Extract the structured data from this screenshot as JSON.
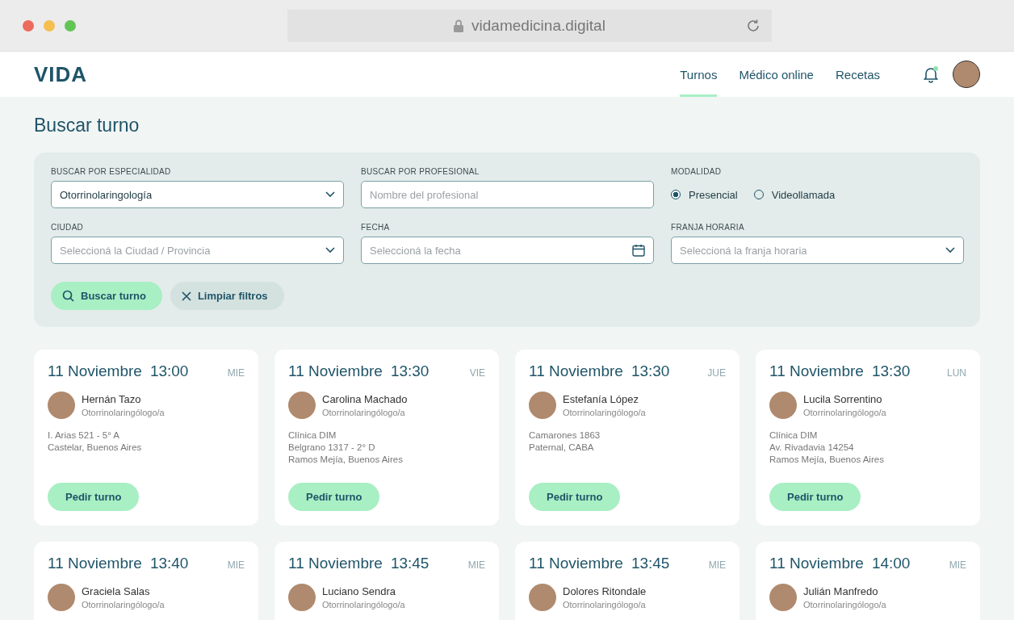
{
  "browser": {
    "url": "vidamedicina.digital"
  },
  "header": {
    "logo": "VIDA",
    "nav": [
      {
        "label": "Turnos",
        "selected": true
      },
      {
        "label": "Médico online",
        "selected": false
      },
      {
        "label": "Recetas",
        "selected": false
      }
    ],
    "notifications_unread": true
  },
  "page_title": "Buscar turno",
  "filters": {
    "especialidad": {
      "label": "BUSCAR POR ESPECIALIDAD",
      "value": "Otorrinolaringología"
    },
    "profesional": {
      "label": "BUSCAR POR PROFESIONAL",
      "placeholder": "Nombre del profesional"
    },
    "modalidad": {
      "label": "MODALIDAD",
      "options": [
        {
          "label": "Presencial",
          "selected": true
        },
        {
          "label": "Videollamada",
          "selected": false
        }
      ]
    },
    "ciudad": {
      "label": "CIUDAD",
      "placeholder": "Seleccioná la Ciudad / Provincia"
    },
    "fecha": {
      "label": "FECHA",
      "placeholder": "Seleccioná la fecha"
    },
    "franja": {
      "label": "FRANJA HORARIA",
      "placeholder": "Seleccioná la franja horaria"
    },
    "buttons": [
      {
        "label": "Buscar turno",
        "kind": "search"
      },
      {
        "label": "Limpiar filtros",
        "kind": "clear"
      }
    ]
  },
  "results": [
    {
      "date": "11 Noviembre",
      "time": "13:00",
      "weekday": "MIE",
      "doctor": "Hernán Tazo",
      "specialty": "Otorrinolaringólogo/a",
      "address": [
        "I. Arias 521 - 5° A",
        "Castelar, Buenos Aires"
      ],
      "action": "Pedir turno"
    },
    {
      "date": "11 Noviembre",
      "time": "13:30",
      "weekday": "VIE",
      "doctor": "Carolina Machado",
      "specialty": "Otorrinolaringólogo/a",
      "address": [
        "Clínica DIM",
        "Belgrano 1317 - 2° D",
        "Ramos Mejía, Buenos Aires"
      ],
      "action": "Pedir turno"
    },
    {
      "date": "11 Noviembre",
      "time": "13:30",
      "weekday": "JUE",
      "doctor": "Estefanía López",
      "specialty": "Otorrinolaringólogo/a",
      "address": [
        "Camarones 1863",
        "Paternal, CABA"
      ],
      "action": "Pedir turno"
    },
    {
      "date": "11 Noviembre",
      "time": "13:30",
      "weekday": "LUN",
      "doctor": "Lucila Sorrentino",
      "specialty": "Otorrinolaringólogo/a",
      "address": [
        "Clínica DIM",
        "Av. Rivadavia 14254",
        "Ramos Mejía, Buenos Aires"
      ],
      "action": "Pedir turno"
    },
    {
      "date": "11 Noviembre",
      "time": "13:40",
      "weekday": "MIE",
      "doctor": "Graciela Salas",
      "specialty": "Otorrinolaringólogo/a"
    },
    {
      "date": "11 Noviembre",
      "time": "13:45",
      "weekday": "MIE",
      "doctor": "Luciano Sendra",
      "specialty": "Otorrinolaringólogo/a"
    },
    {
      "date": "11 Noviembre",
      "time": "13:45",
      "weekday": "MIE",
      "doctor": "Dolores Ritondale",
      "specialty": "Otorrinolaringólogo/a"
    },
    {
      "date": "11 Noviembre",
      "time": "14:00",
      "weekday": "MIE",
      "doctor": "Julián Manfredo",
      "specialty": "Otorrinolaringólogo/a"
    }
  ]
}
